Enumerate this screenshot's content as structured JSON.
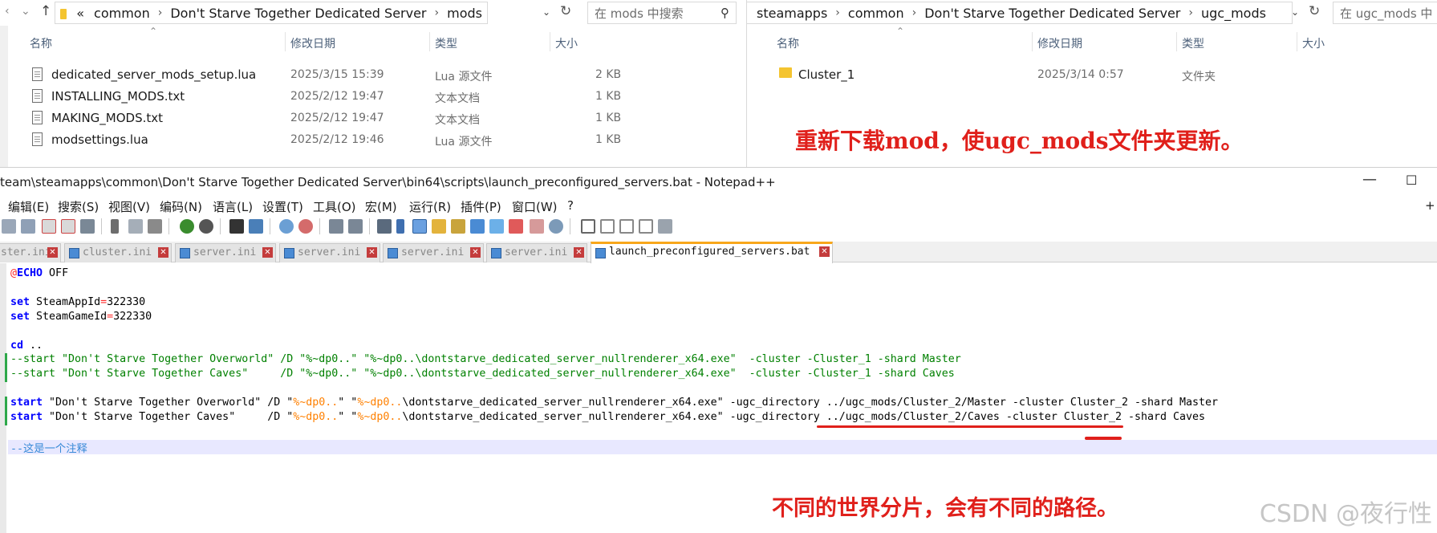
{
  "left_explorer": {
    "path": [
      "«",
      "common",
      "Don't Starve Together Dedicated Server",
      "mods"
    ],
    "search_placeholder": "在 mods 中搜索",
    "columns": {
      "name": "名称",
      "date": "修改日期",
      "type": "类型",
      "size": "大小"
    },
    "files": [
      {
        "name": "dedicated_server_mods_setup.lua",
        "date": "2025/3/15 15:39",
        "type": "Lua 源文件",
        "size": "2 KB"
      },
      {
        "name": "INSTALLING_MODS.txt",
        "date": "2025/2/12 19:47",
        "type": "文本文档",
        "size": "1 KB"
      },
      {
        "name": "MAKING_MODS.txt",
        "date": "2025/2/12 19:47",
        "type": "文本文档",
        "size": "1 KB"
      },
      {
        "name": "modsettings.lua",
        "date": "2025/2/12 19:46",
        "type": "Lua 源文件",
        "size": "1 KB"
      }
    ]
  },
  "right_explorer": {
    "path": [
      "steamapps",
      "common",
      "Don't Starve Together Dedicated Server",
      "ugc_mods"
    ],
    "search_placeholder": "在 ugc_mods 中",
    "columns": {
      "name": "名称",
      "date": "修改日期",
      "type": "类型",
      "size": "大小"
    },
    "files": [
      {
        "name": "Cluster_1",
        "date": "2025/3/14 0:57",
        "type": "文件夹",
        "size": ""
      }
    ]
  },
  "annotations": {
    "top": "重新下载mod，使ugc_mods文件夹更新。",
    "bottom": "不同的世界分片，会有不同的路径。"
  },
  "notepad": {
    "title": "team\\steamapps\\common\\Don't Starve Together Dedicated Server\\bin64\\scripts\\launch_preconfigured_servers.bat - Notepad++",
    "menu": [
      "编辑(E)",
      "搜索(S)",
      "视图(V)",
      "编码(N)",
      "语言(L)",
      "设置(T)",
      "工具(O)",
      "宏(M)",
      "运行(R)",
      "插件(P)",
      "窗口(W)",
      "?"
    ],
    "menu_plus": "+",
    "tabs": [
      "ster.ini",
      "cluster.ini",
      "server.ini",
      "server.ini",
      "server.ini",
      "server.ini",
      "launch_preconfigured_servers.bat"
    ],
    "code": {
      "l1_at": "@",
      "l1_kw": "ECHO",
      "l1_rest": " OFF",
      "l3_kw": "set",
      "l3_rest": " SteamAppId",
      "l3_eq": "=",
      "l3_val": "322330",
      "l4_kw": "set",
      "l4_rest": " SteamGameId",
      "l4_eq": "=",
      "l4_val": "322330",
      "l6_kw": "cd",
      "l6_rest": " ..",
      "l7": "--start \"Don't Starve Together Overworld\" /D \"%~dp0..\" \"%~dp0..\\dontstarve_dedicated_server_nullrenderer_x64.exe\"  -cluster -Cluster_1 -shard Master",
      "l8": "--start \"Don't Starve Together Caves\"     /D \"%~dp0..\" \"%~dp0..\\dontstarve_dedicated_server_nullrenderer_x64.exe\"  -cluster -Cluster_1 -shard Caves",
      "l10_kw": "start",
      "l10_a": " \"Don't Starve Together Overworld\" /D \"",
      "l10_v1": "%~dp0..",
      "l10_b": "\" \"",
      "l10_v2": "%~dp0..",
      "l10_c": "\\dontstarve_dedicated_server_nullrenderer_x64.exe\" -ugc_directory ../ugc_mods/Cluster_2/Master -cluster Cluster_2 -shard Master",
      "l11_kw": "start",
      "l11_a": " \"Don't Starve Together Caves\"     /D \"",
      "l11_v1": "%~dp0..",
      "l11_b": "\" \"",
      "l11_v2": "%~dp0..",
      "l11_c": "\\dontstarve_dedicated_server_nullrenderer_x64.exe\" -ugc_directory ../ugc_mods/Cluster_2/Caves -cluster Cluster_2 -shard Caves",
      "l13": "--这是一个注释"
    }
  },
  "watermark": "CSDN @夜行性",
  "colors": {
    "annotation": "#e0201b",
    "keyword": "#0000ff",
    "comment": "#008000",
    "variable": "#ff8000",
    "tab_active_accent": "#f8a71b"
  }
}
